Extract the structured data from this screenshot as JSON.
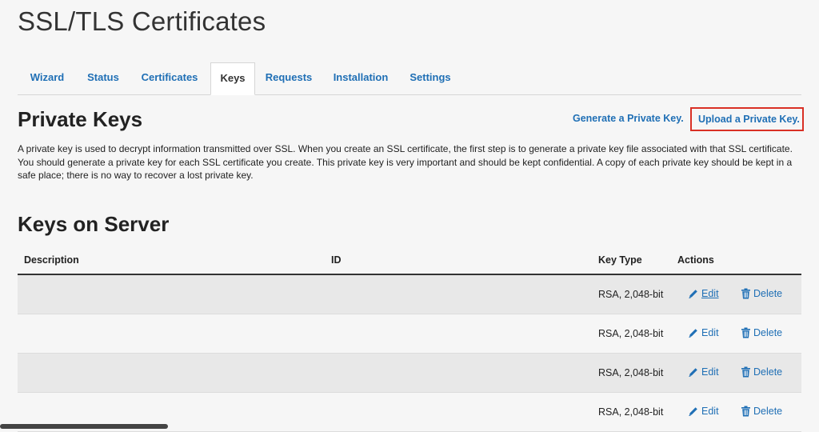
{
  "page": {
    "title": "SSL/TLS Certificates"
  },
  "tabs": [
    {
      "label": "Wizard"
    },
    {
      "label": "Status"
    },
    {
      "label": "Certificates"
    },
    {
      "label": "Keys"
    },
    {
      "label": "Requests"
    },
    {
      "label": "Installation"
    },
    {
      "label": "Settings"
    }
  ],
  "active_tab": "Keys",
  "private_keys": {
    "title": "Private Keys",
    "generate_link": "Generate a Private Key.",
    "upload_link": "Upload a Private Key.",
    "description": "A private key is used to decrypt information transmitted over SSL. When you create an SSL certificate, the first step is to generate a private key file associated with that SSL certificate. You should generate a private key for each SSL certificate you create. This private key is very important and should be kept confidential. A copy of each private key should be kept in a safe place; there is no way to recover a lost private key."
  },
  "keys_on_server": {
    "title": "Keys on Server",
    "columns": [
      "Description",
      "ID",
      "Key Type",
      "Actions"
    ],
    "rows": [
      {
        "description": "",
        "id": "",
        "key_type": "RSA, 2,048-bit",
        "edit": "Edit",
        "delete": "Delete"
      },
      {
        "description": "",
        "id": "",
        "key_type": "RSA, 2,048-bit",
        "edit": "Edit",
        "delete": "Delete"
      },
      {
        "description": "",
        "id": "",
        "key_type": "RSA, 2,048-bit",
        "edit": "Edit",
        "delete": "Delete"
      },
      {
        "description": "",
        "id": "",
        "key_type": "RSA, 2,048-bit",
        "edit": "Edit",
        "delete": "Delete"
      }
    ]
  },
  "colors": {
    "link": "#1f6fb5",
    "highlight_border": "#d93025",
    "row_alt": "#e8e8e8",
    "background": "#f6f6f6"
  },
  "icons": {
    "edit": "pencil-icon",
    "delete": "trash-icon"
  }
}
